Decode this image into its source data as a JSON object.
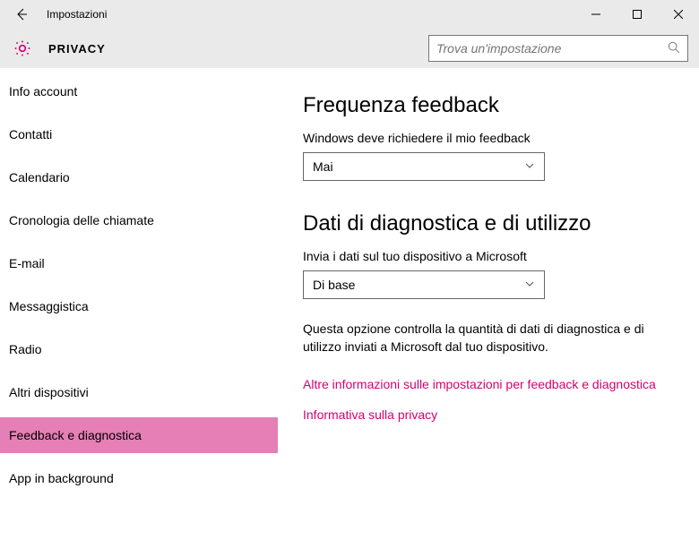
{
  "window": {
    "title": "Impostazioni"
  },
  "header": {
    "page_title": "PRIVACY",
    "search_placeholder": "Trova un'impostazione"
  },
  "sidebar": {
    "items": [
      {
        "label": "Info account"
      },
      {
        "label": "Contatti"
      },
      {
        "label": "Calendario"
      },
      {
        "label": "Cronologia delle chiamate"
      },
      {
        "label": "E-mail"
      },
      {
        "label": "Messaggistica"
      },
      {
        "label": "Radio"
      },
      {
        "label": "Altri dispositivi"
      },
      {
        "label": "Feedback e diagnostica"
      },
      {
        "label": "App in background"
      }
    ],
    "active_index": 8
  },
  "main": {
    "section1": {
      "heading": "Frequenza feedback",
      "label": "Windows deve richiedere il mio feedback",
      "dropdown_value": "Mai"
    },
    "section2": {
      "heading": "Dati di diagnostica e di utilizzo",
      "label": "Invia i dati sul tuo dispositivo a Microsoft",
      "dropdown_value": "Di base",
      "description": "Questa opzione controlla la quantità di dati di diagnostica e di utilizzo inviati a Microsoft dal tuo dispositivo."
    },
    "links": {
      "more_info": "Altre informazioni sulle impostazioni per feedback e diagnostica",
      "privacy": "Informativa sulla privacy"
    }
  }
}
